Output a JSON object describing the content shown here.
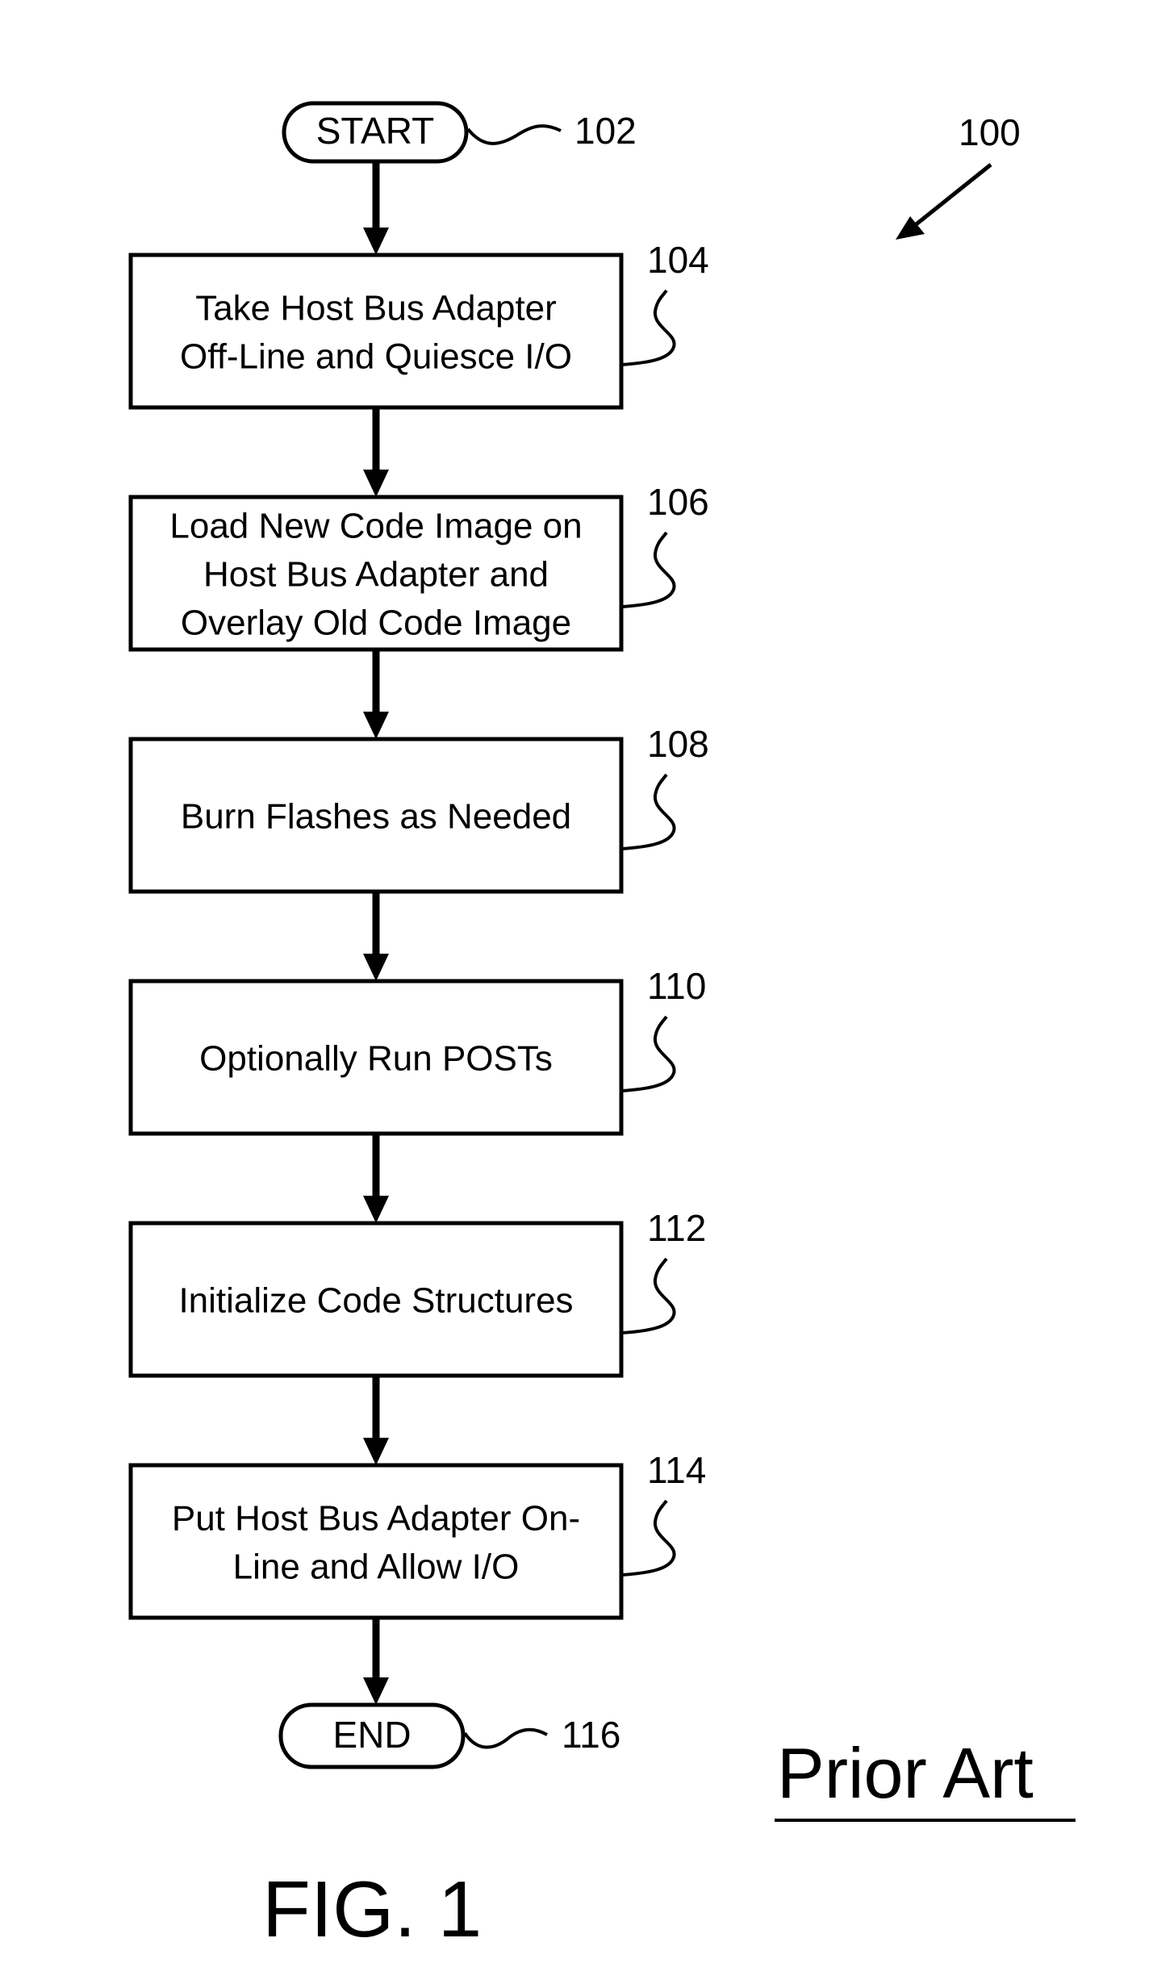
{
  "figure": {
    "figure_ref": "100",
    "caption": "FIG. 1",
    "annotation": "Prior Art"
  },
  "start": {
    "label": "START",
    "ref": "102"
  },
  "steps": [
    {
      "ref": "104",
      "lines": [
        "Take Host Bus Adapter",
        "Off-Line and Quiesce I/O"
      ]
    },
    {
      "ref": "106",
      "lines": [
        "Load New Code Image on",
        "Host Bus Adapter and",
        "Overlay Old Code Image"
      ]
    },
    {
      "ref": "108",
      "lines": [
        "Burn Flashes as Needed"
      ]
    },
    {
      "ref": "110",
      "lines": [
        "Optionally Run POSTs"
      ]
    },
    {
      "ref": "112",
      "lines": [
        "Initialize Code Structures"
      ]
    },
    {
      "ref": "114",
      "lines": [
        "Put Host Bus Adapter On-",
        "Line and Allow I/O"
      ]
    }
  ],
  "end": {
    "label": "END",
    "ref": "116"
  },
  "colors": {
    "ink": "#000000",
    "paper": "#ffffff"
  }
}
